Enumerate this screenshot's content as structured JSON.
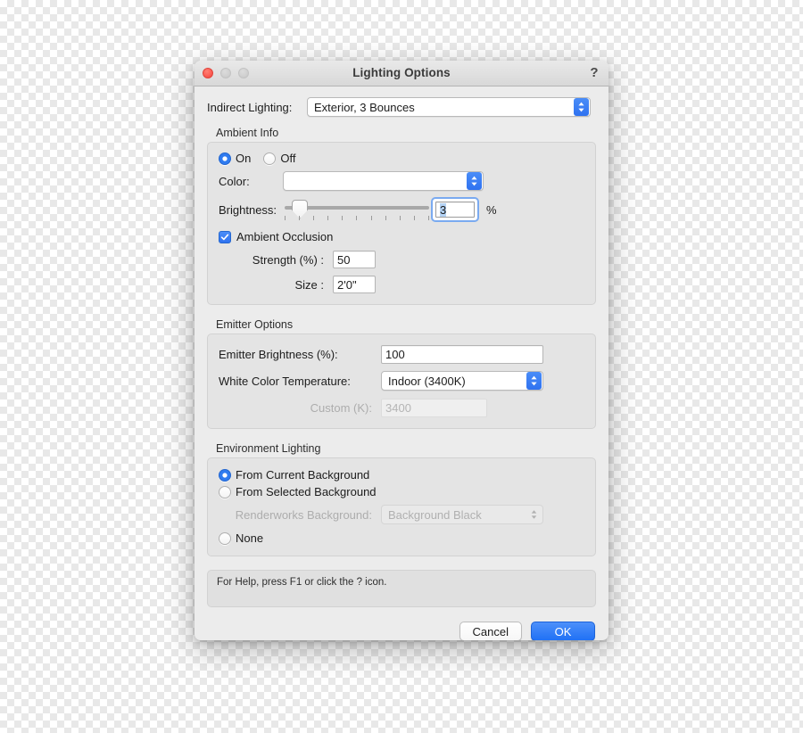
{
  "window": {
    "title": "Lighting Options",
    "help_icon": "question-mark-icon",
    "close_label": "",
    "minimize_label": "",
    "maximize_label": ""
  },
  "indirect_lighting": {
    "label": "Indirect Lighting:",
    "value": "Exterior, 3 Bounces"
  },
  "ambient_info": {
    "title": "Ambient Info",
    "on_label": "On",
    "off_label": "Off",
    "state": "On",
    "color_label": "Color:",
    "color_value": "",
    "brightness_label": "Brightness:",
    "brightness_value": "3",
    "brightness_unit": "%",
    "occlusion_label": "Ambient Occlusion",
    "occlusion_checked": true,
    "strength_label": "Strength (%) :",
    "strength_value": "50",
    "size_label": "Size :",
    "size_value": "2'0\""
  },
  "emitter_options": {
    "title": "Emitter Options",
    "brightness_label": "Emitter Brightness (%):",
    "brightness_value": "100",
    "temperature_label": "White Color Temperature:",
    "temperature_value": "Indoor (3400K)",
    "custom_label": "Custom (K):",
    "custom_value": "3400"
  },
  "environment_lighting": {
    "title": "Environment Lighting",
    "option_current": "From Current Background",
    "option_selected": "From Selected Background",
    "option_none": "None",
    "chosen": "From Current Background",
    "renderworks_label": "Renderworks Background:",
    "renderworks_value": "Background Black"
  },
  "footer": {
    "help_text": "For Help, press F1 or click the ? icon.",
    "cancel_label": "Cancel",
    "ok_label": "OK"
  },
  "colors": {
    "accent_blue": "#2f72f0",
    "window_bg": "#ececec",
    "group_bg": "#e4e4e4",
    "close_red": "#fc5e55"
  }
}
